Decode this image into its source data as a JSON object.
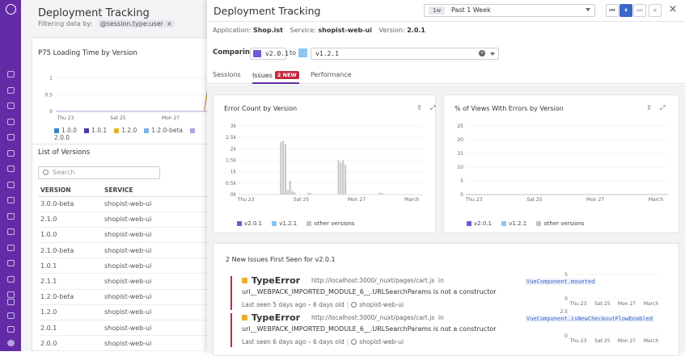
{
  "nav": {
    "icons": [
      "paw-logo",
      "search-icon",
      "binoculars-icon",
      "list-icon",
      "chart-icon",
      "grid-icon",
      "puzzle-icon",
      "gauge-icon",
      "bug-icon",
      "monitor-icon",
      "lines-icon",
      "hierarchy-icon",
      "shield-icon",
      "book-icon",
      "database-icon",
      "lock-icon",
      "gear-icon",
      "chat-icon",
      "help-icon",
      "user-avatar"
    ]
  },
  "background": {
    "title": "Deployment Tracking",
    "filter_label": "Filtering data by:",
    "filter_chip": "@session.type:user",
    "chart_title": "P75 Loading Time by Version",
    "legend": [
      {
        "label": "1.0.0",
        "color": "#3b82c8"
      },
      {
        "label": "1.0.1",
        "color": "#4b3aa8"
      },
      {
        "label": "1.2.0",
        "color": "#e8b028"
      },
      {
        "label": "1.2.0-beta",
        "color": "#7ab0e8"
      },
      {
        "label": "2.0.0",
        "color": "#a8a4e6"
      }
    ],
    "list_title": "List of Versions",
    "search_placeholder": "Search",
    "columns": [
      "VERSION",
      "SERVICE"
    ],
    "rows": [
      [
        "3.0.0-beta",
        "shopist-web-ui"
      ],
      [
        "2.1.0",
        "shopist-web-ui"
      ],
      [
        "1.0.0",
        "shopist-web-ui"
      ],
      [
        "2.1.0-beta",
        "shopist-web-ui"
      ],
      [
        "1.0.1",
        "shopist-web-ui"
      ],
      [
        "2.1.1",
        "shopist-web-ui"
      ],
      [
        "1.2.0-beta",
        "shopist-web-ui"
      ],
      [
        "1.2.0",
        "shopist-web-ui"
      ],
      [
        "2.0.1",
        "shopist-web-ui"
      ],
      [
        "2.0.0",
        "shopist-web-ui"
      ]
    ]
  },
  "panel": {
    "title": "Deployment Tracking",
    "time_chip": "1w",
    "time_label": "Past 1 Week",
    "info": {
      "app_label": "Application:",
      "app": "Shop.ist",
      "service_label": "Service:",
      "service": "shopist-web-ui",
      "version_label": "Version:",
      "version": "2.0.1"
    },
    "comparing_label": "Comparing",
    "version_a": "v2.0.1",
    "to_label": "to",
    "version_b": "v1.2.1",
    "tabs": [
      "Sessions",
      "Issues",
      "Performance"
    ],
    "issues_badge": "2 NEW",
    "colors": {
      "v201": "#6b5bd6",
      "v121": "#8fc4ee",
      "other": "#c4c4c8"
    }
  },
  "chart_data": [
    {
      "type": "line",
      "title": "P75 Loading Time by Version",
      "x_ticks": [
        "Thu 23",
        "Sat 25",
        "Mon 27"
      ],
      "y_ticks": [
        "0",
        "0.5",
        "1"
      ],
      "ylim": [
        0,
        1.1
      ],
      "series": [
        {
          "name": "1.0.0",
          "values": [
            0,
            0,
            0,
            0,
            0,
            0,
            0,
            0,
            0,
            0,
            0,
            0,
            0,
            0,
            0,
            0,
            0,
            0,
            0,
            0,
            0,
            0,
            0,
            0,
            0,
            0,
            0,
            0,
            0,
            0
          ]
        },
        {
          "name": "1.0.1",
          "values": [
            0,
            0,
            0,
            0,
            0,
            0,
            0,
            0,
            0,
            0,
            0,
            0,
            0,
            0,
            0,
            0,
            0,
            0,
            0,
            0,
            0,
            0,
            0,
            0,
            0,
            0,
            0,
            0,
            0,
            1
          ]
        },
        {
          "name": "1.2.0",
          "values": [
            0,
            0,
            0,
            0,
            0,
            0,
            0,
            0,
            0,
            0,
            0,
            0,
            0,
            0,
            0,
            0,
            0,
            0,
            0,
            0,
            0,
            0,
            0,
            0,
            0,
            0,
            0,
            0,
            0,
            0.9
          ]
        },
        {
          "name": "1.2.0-beta",
          "values": [
            0,
            0,
            0,
            0,
            0,
            0,
            0,
            0,
            0,
            0,
            0,
            0,
            0,
            0,
            0,
            0,
            0,
            0,
            0,
            0,
            0,
            0,
            0,
            0,
            0,
            0,
            0,
            0,
            0,
            0
          ]
        },
        {
          "name": "2.0.0",
          "values": [
            0,
            0,
            0,
            0,
            0,
            0,
            0,
            0,
            0,
            0,
            0,
            0,
            0,
            0,
            0,
            0,
            0,
            0,
            0,
            0,
            0,
            0,
            0,
            0,
            0,
            0,
            0,
            0,
            0,
            0
          ]
        }
      ]
    },
    {
      "type": "bar",
      "title": "Error Count by Version",
      "x_ticks": [
        "Thu 23",
        "Sat 25",
        "Mon 27",
        "March"
      ],
      "y_ticks": [
        "0k",
        "0.5k",
        "1k",
        "1.5k",
        "2k",
        "2.5k",
        "3k"
      ],
      "ylim": [
        0,
        3000
      ],
      "series": [
        {
          "name": "v2.0.1",
          "values": [
            0,
            0,
            0,
            0,
            0,
            0,
            0,
            0,
            0,
            0,
            0,
            0,
            0,
            0,
            0,
            0,
            0,
            0,
            0,
            0,
            0,
            0,
            0,
            0,
            0,
            0,
            0,
            0,
            0,
            0,
            0,
            0,
            0,
            0,
            0,
            0,
            0,
            0,
            0,
            0,
            0,
            0,
            0,
            0,
            0,
            0,
            0,
            0,
            0,
            0,
            0,
            0,
            0,
            0,
            0,
            0,
            0,
            0,
            0,
            0,
            0,
            0,
            0,
            0,
            0,
            0,
            0,
            0,
            0,
            0,
            0,
            0,
            0,
            0,
            0,
            0,
            0,
            0,
            0,
            0
          ]
        },
        {
          "name": "v1.2.1",
          "values": [
            0,
            0,
            0,
            0,
            0,
            0,
            0,
            0,
            0,
            0,
            0,
            0,
            0,
            0,
            0,
            0,
            0,
            0,
            0,
            0,
            0,
            0,
            0,
            0,
            0,
            0,
            0,
            0,
            0,
            0,
            0,
            0,
            0,
            0,
            0,
            0,
            0,
            0,
            0,
            0,
            0,
            0,
            0,
            0,
            0,
            0,
            0,
            0,
            0,
            0,
            0,
            0,
            0,
            0,
            0,
            0,
            0,
            0,
            0,
            0,
            0,
            0,
            0,
            0,
            0,
            0,
            0,
            0,
            0,
            0,
            0,
            0,
            0,
            0,
            0,
            0,
            0,
            0,
            0,
            0
          ]
        },
        {
          "name": "other versions",
          "values": [
            0,
            0,
            0,
            0,
            0,
            0,
            0,
            0,
            0,
            0,
            0,
            0,
            0,
            0,
            0,
            0,
            0,
            0,
            2300,
            2350,
            2200,
            200,
            600,
            150,
            100,
            0,
            0,
            0,
            0,
            0,
            80,
            60,
            0,
            0,
            0,
            0,
            0,
            0,
            0,
            0,
            0,
            0,
            0,
            1500,
            1400,
            1500,
            1300,
            0,
            0,
            0,
            0,
            0,
            0,
            0,
            0,
            0,
            0,
            0,
            0,
            0,
            0,
            80,
            60,
            0,
            0,
            0,
            0,
            0,
            0,
            0,
            0,
            0,
            0,
            0,
            0,
            0,
            0,
            0,
            0,
            0
          ]
        }
      ]
    },
    {
      "type": "line",
      "title": "% of Views With Errors by Version",
      "x_ticks": [
        "Thu 23",
        "Sat 25",
        "Mon 27",
        "March"
      ],
      "y_ticks": [
        "0",
        "5",
        "10",
        "15",
        "20",
        "25"
      ],
      "ylim": [
        0,
        27
      ],
      "series": [
        {
          "name": "v2.0.1",
          "values": [
            0,
            0,
            0,
            0,
            0,
            0,
            0,
            0,
            0,
            0,
            0,
            0,
            0,
            0,
            0,
            0,
            0,
            0,
            0,
            0,
            0,
            0,
            0,
            0,
            0,
            0,
            0,
            0,
            0,
            0,
            0,
            0,
            0,
            0,
            0,
            0,
            0,
            0,
            0,
            0,
            0,
            0,
            0,
            0,
            0,
            0,
            0,
            0,
            0,
            0,
            0,
            0,
            0,
            0,
            0,
            0,
            0,
            0,
            0,
            0,
            0,
            0,
            0,
            0,
            0,
            0,
            0,
            0,
            0,
            0,
            0,
            0,
            0,
            0,
            0,
            0,
            0,
            0,
            0,
            0
          ]
        },
        {
          "name": "v1.2.1",
          "values": [
            0,
            0,
            0,
            0,
            0,
            0,
            0,
            0,
            0,
            0,
            0,
            0,
            0,
            0,
            0,
            0,
            0,
            0,
            0,
            0,
            0,
            0,
            0,
            0,
            0,
            0,
            0,
            0,
            0,
            0,
            0,
            0,
            0,
            0,
            0,
            0,
            0,
            0,
            0,
            0,
            0,
            0,
            0,
            0,
            0,
            0,
            0,
            0,
            0,
            0,
            0,
            0,
            0,
            0,
            0,
            0,
            0,
            0,
            0,
            0,
            0,
            0,
            0,
            0,
            0,
            0,
            0,
            0,
            0,
            0,
            0,
            0,
            0,
            0,
            0,
            0,
            0,
            0,
            0,
            0
          ]
        },
        {
          "name": "other versions",
          "values": [
            0,
            0,
            0,
            0,
            0,
            0,
            0,
            0,
            0,
            0,
            0,
            0,
            0,
            0,
            0,
            0,
            0,
            0,
            0,
            0,
            0,
            0,
            0,
            0,
            0,
            0,
            0,
            0,
            0,
            0,
            0,
            0,
            0,
            0,
            0,
            0,
            0,
            0,
            0,
            0,
            0,
            0,
            0,
            0,
            0,
            0,
            0,
            0,
            0,
            0,
            0,
            0,
            0,
            0,
            0,
            0,
            0,
            0,
            0,
            0,
            0,
            0,
            0,
            0,
            0,
            0,
            0,
            0,
            0,
            0,
            0,
            0,
            0,
            0,
            0,
            0,
            0,
            0,
            0,
            0
          ]
        }
      ]
    },
    {
      "type": "bar",
      "title": "",
      "x_ticks": [
        "Thu 23",
        "Sat 25",
        "Mon 27",
        "March"
      ],
      "y_ticks": [
        "0",
        "5"
      ],
      "ylim": [
        0,
        5
      ],
      "series": [
        {
          "values": [
            0,
            0,
            0,
            0,
            0,
            0,
            0,
            0,
            0,
            0,
            0,
            0,
            0,
            0,
            0,
            0,
            0,
            0,
            0,
            0,
            0,
            0,
            0,
            0,
            0,
            0,
            0,
            0,
            0,
            0
          ]
        }
      ]
    },
    {
      "type": "bar",
      "title": "",
      "x_ticks": [
        "Thu 23",
        "Sat 25",
        "Mon 27",
        "March"
      ],
      "y_ticks": [
        "0",
        "2.5"
      ],
      "ylim": [
        0,
        2.5
      ],
      "series": [
        {
          "values": [
            0,
            0,
            0,
            0,
            0,
            0,
            0,
            0,
            0,
            0,
            0,
            0,
            0,
            0,
            0,
            0,
            0,
            0,
            0,
            0,
            0,
            0,
            0,
            0,
            0,
            0,
            0,
            0,
            0,
            0
          ]
        }
      ]
    }
  ],
  "issues": {
    "heading": "2 New Issues First Seen for v2.0.1",
    "items": [
      {
        "type": "TypeError",
        "url": "http://localhost:3000/_nuxt/pages/cart.js",
        "in": "in",
        "function": "VueComponent.mounted",
        "message": "url__WEBPACK_IMPORTED_MODULE_6__.URLSearchParams is not a constructor",
        "seen": "Last seen 5 days ago – 6 days old",
        "service": "shopist-web-ui"
      },
      {
        "type": "TypeError",
        "url": "http://localhost:3000/_nuxt/pages/cart.js",
        "in": "in",
        "function": "VueComponent.isNewCheckoutFlowEnabled",
        "message": "url__WEBPACK_IMPORTED_MODULE_6__.URLSearchParams is not a constructor",
        "seen": "Last seen 6 days ago – 6 days old",
        "service": "shopist-web-ui"
      }
    ]
  }
}
